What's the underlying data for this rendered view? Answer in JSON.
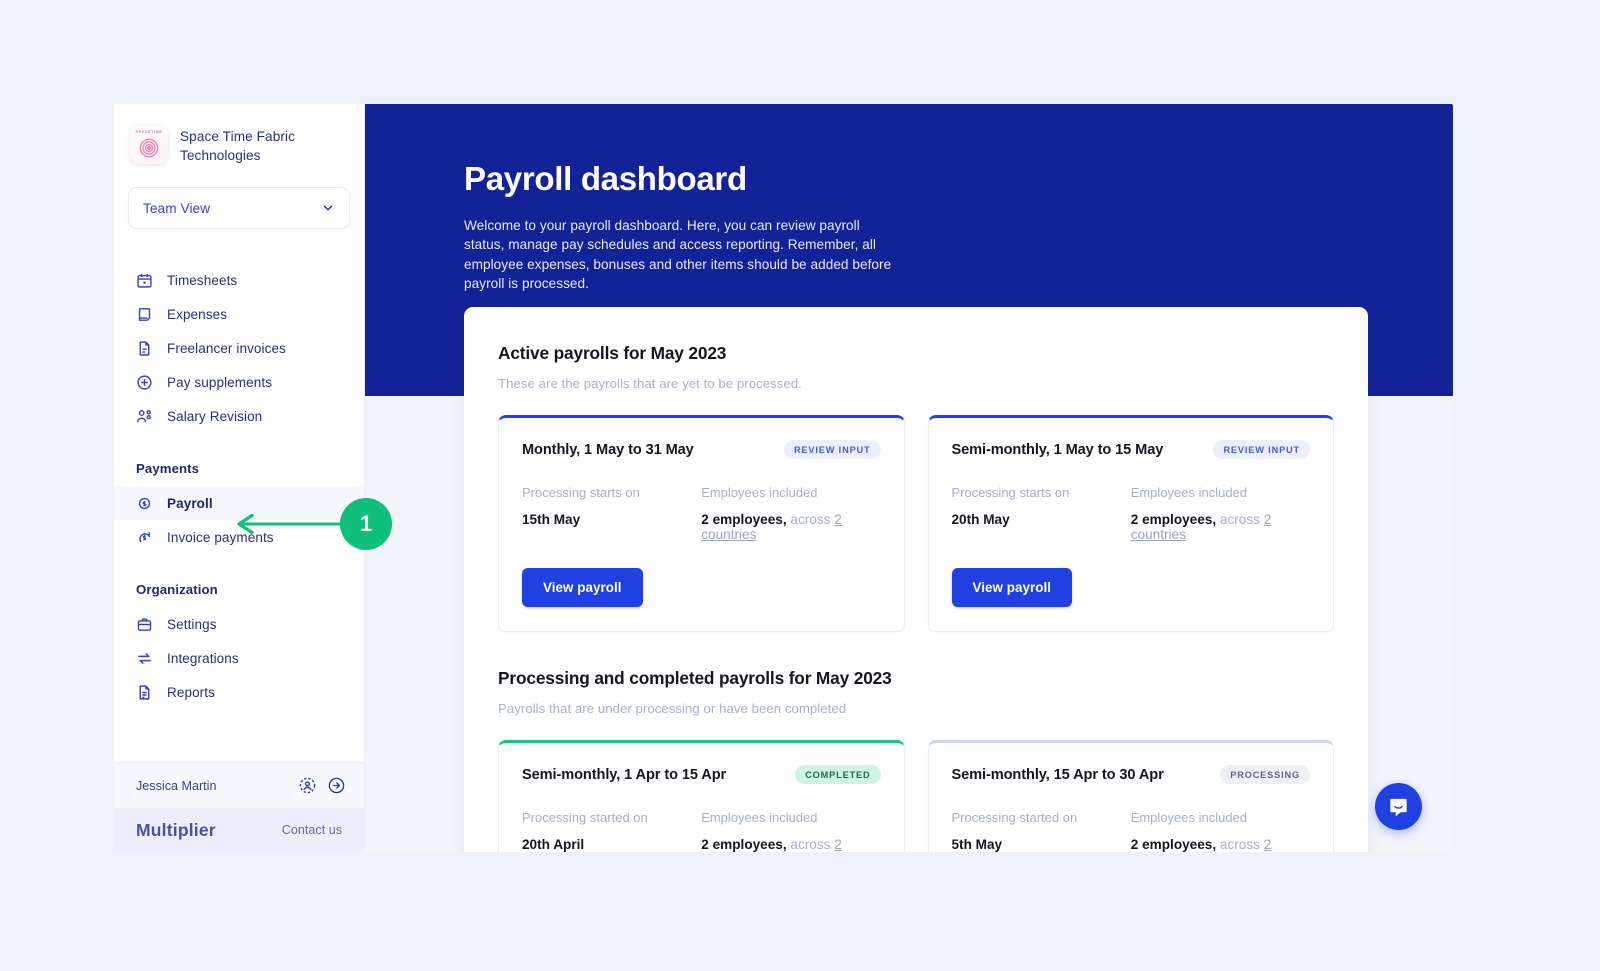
{
  "sidebar": {
    "org": {
      "name": "Space Time Fabric Technologies",
      "logo_word": "SPACETIME",
      "logo_icon": "spiral-logo-icon"
    },
    "team_select": {
      "value": "Team View",
      "chevron": "chevron-down-icon"
    },
    "nav_primary": [
      {
        "label": "Timesheets",
        "icon": "calendar-icon"
      },
      {
        "label": "Expenses",
        "icon": "receipt-icon"
      },
      {
        "label": "Freelancer invoices",
        "icon": "document-icon"
      },
      {
        "label": "Pay supplements",
        "icon": "plus-circle-icon"
      },
      {
        "label": "Salary Revision",
        "icon": "people-icon"
      }
    ],
    "section_payments": {
      "heading": "Payments",
      "items": [
        {
          "label": "Payroll",
          "icon": "payroll-icon",
          "active": true
        },
        {
          "label": "Invoice payments",
          "icon": "invoice-dollar-icon",
          "active": false
        }
      ]
    },
    "section_organization": {
      "heading": "Organization",
      "items": [
        {
          "label": "Settings",
          "icon": "briefcase-icon"
        },
        {
          "label": "Integrations",
          "icon": "exchange-arrows-icon"
        },
        {
          "label": "Reports",
          "icon": "report-document-icon"
        }
      ]
    },
    "user": {
      "name": "Jessica Martin",
      "profile_icon": "user-circle-icon",
      "logout_icon": "arrow-right-circle-icon"
    },
    "footer": {
      "brand": "Multiplier",
      "contact": "Contact us"
    }
  },
  "hero": {
    "title": "Payroll dashboard",
    "description": "Welcome to your payroll dashboard. Here, you can review payroll status, manage pay schedules and access reporting. Remember, all employee expenses, bonuses and other items should be added before payroll is processed."
  },
  "active_section": {
    "title": "Active payrolls for May 2023",
    "subtitle": "These are the payrolls that are yet to be processed.",
    "cards": [
      {
        "title": "Monthly, 1 May to 31 May",
        "badge": "REVIEW INPUT",
        "date_label": "Processing starts on",
        "date_value": "15th May",
        "employees_label": "Employees included",
        "employees_value": "2 employees,",
        "employees_suffix": "across",
        "countries_link": "2 countries",
        "button": "View payroll"
      },
      {
        "title": "Semi-monthly, 1 May to 15 May",
        "badge": "REVIEW INPUT",
        "date_label": "Processing starts on",
        "date_value": "20th May",
        "employees_label": "Employees included",
        "employees_value": "2 employees,",
        "employees_suffix": "across",
        "countries_link": "2 countries",
        "button": "View payroll"
      }
    ]
  },
  "processing_section": {
    "title": "Processing and completed payrolls for May 2023",
    "subtitle": "Payrolls that are under processing or have been completed",
    "cards": [
      {
        "title": "Semi-monthly, 1 Apr to 15 Apr",
        "badge": "COMPLETED",
        "date_label": "Processing started on",
        "date_value": "20th April",
        "employees_label": "Employees included",
        "employees_value": "2 employees,",
        "employees_suffix": "across",
        "countries_link": "2"
      },
      {
        "title": "Semi-monthly, 15 Apr to 30 Apr",
        "badge": "PROCESSING",
        "date_label": "Processing started on",
        "date_value": "5th May",
        "employees_label": "Employees included",
        "employees_value": "2 employees,",
        "employees_suffix": "across",
        "countries_link": "2"
      }
    ]
  },
  "annotation": {
    "step_number": "1",
    "icon": "arrow-left-icon"
  },
  "chat": {
    "icon": "intercom-chat-icon"
  },
  "colors": {
    "hero_blue": "#132397",
    "primary_blue": "#2140e0",
    "nav_text": "#2b2f7a",
    "accent_green": "#0ec07a",
    "completed_green": "#ccf5e3",
    "page_background": "#eef2fd",
    "panel_background": "#f2f4f9"
  }
}
